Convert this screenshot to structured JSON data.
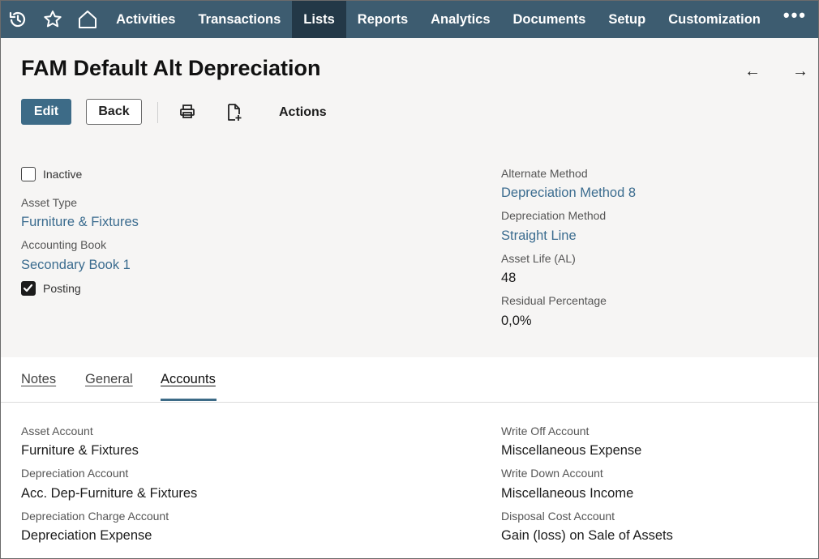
{
  "nav": {
    "icons": [
      "recent-icon",
      "star-icon",
      "home-icon"
    ],
    "items": [
      {
        "label": "Activities",
        "active": false
      },
      {
        "label": "Transactions",
        "active": false
      },
      {
        "label": "Lists",
        "active": true
      },
      {
        "label": "Reports",
        "active": false
      },
      {
        "label": "Analytics",
        "active": false
      },
      {
        "label": "Documents",
        "active": false
      },
      {
        "label": "Setup",
        "active": false
      },
      {
        "label": "Customization",
        "active": false
      }
    ],
    "more": "•••"
  },
  "header": {
    "title": "FAM Default Alt Depreciation",
    "prev_arrow": "←",
    "next_arrow": "→",
    "edit_label": "Edit",
    "back_label": "Back",
    "actions_label": "Actions"
  },
  "fields": {
    "inactive": {
      "label": "Inactive",
      "checked": false
    },
    "asset_type": {
      "label": "Asset Type",
      "value": "Furniture & Fixtures"
    },
    "accounting_book": {
      "label": "Accounting Book",
      "value": "Secondary Book 1"
    },
    "posting": {
      "label": "Posting",
      "checked": true
    },
    "alternate_method": {
      "label": "Alternate Method",
      "value": "Depreciation Method 8"
    },
    "depreciation_method": {
      "label": "Depreciation Method",
      "value": "Straight Line"
    },
    "asset_life": {
      "label": "Asset Life (AL)",
      "value": "48"
    },
    "residual_percentage": {
      "label": "Residual Percentage",
      "value": "0,0%"
    }
  },
  "tabs": [
    {
      "label": "Notes",
      "active": false
    },
    {
      "label": "General",
      "active": false
    },
    {
      "label": "Accounts",
      "active": true
    }
  ],
  "accounts": {
    "asset_account": {
      "label": "Asset Account",
      "value": "Furniture & Fixtures"
    },
    "depreciation_account": {
      "label": "Depreciation Account",
      "value": "Acc. Dep-Furniture & Fixtures"
    },
    "depreciation_charge_account": {
      "label": "Depreciation Charge Account",
      "value": "Depreciation Expense"
    },
    "write_off_account": {
      "label": "Write Off Account",
      "value": "Miscellaneous Expense"
    },
    "write_down_account": {
      "label": "Write Down Account",
      "value": "Miscellaneous Income"
    },
    "disposal_cost_account": {
      "label": "Disposal Cost Account",
      "value": "Gain (loss) on Sale of Assets"
    }
  },
  "colors": {
    "nav_bg": "#3d5c70",
    "nav_active": "#233847",
    "primary_button": "#3d6b87",
    "link": "#3b6c8f",
    "header_bg": "#f6f5f4"
  }
}
